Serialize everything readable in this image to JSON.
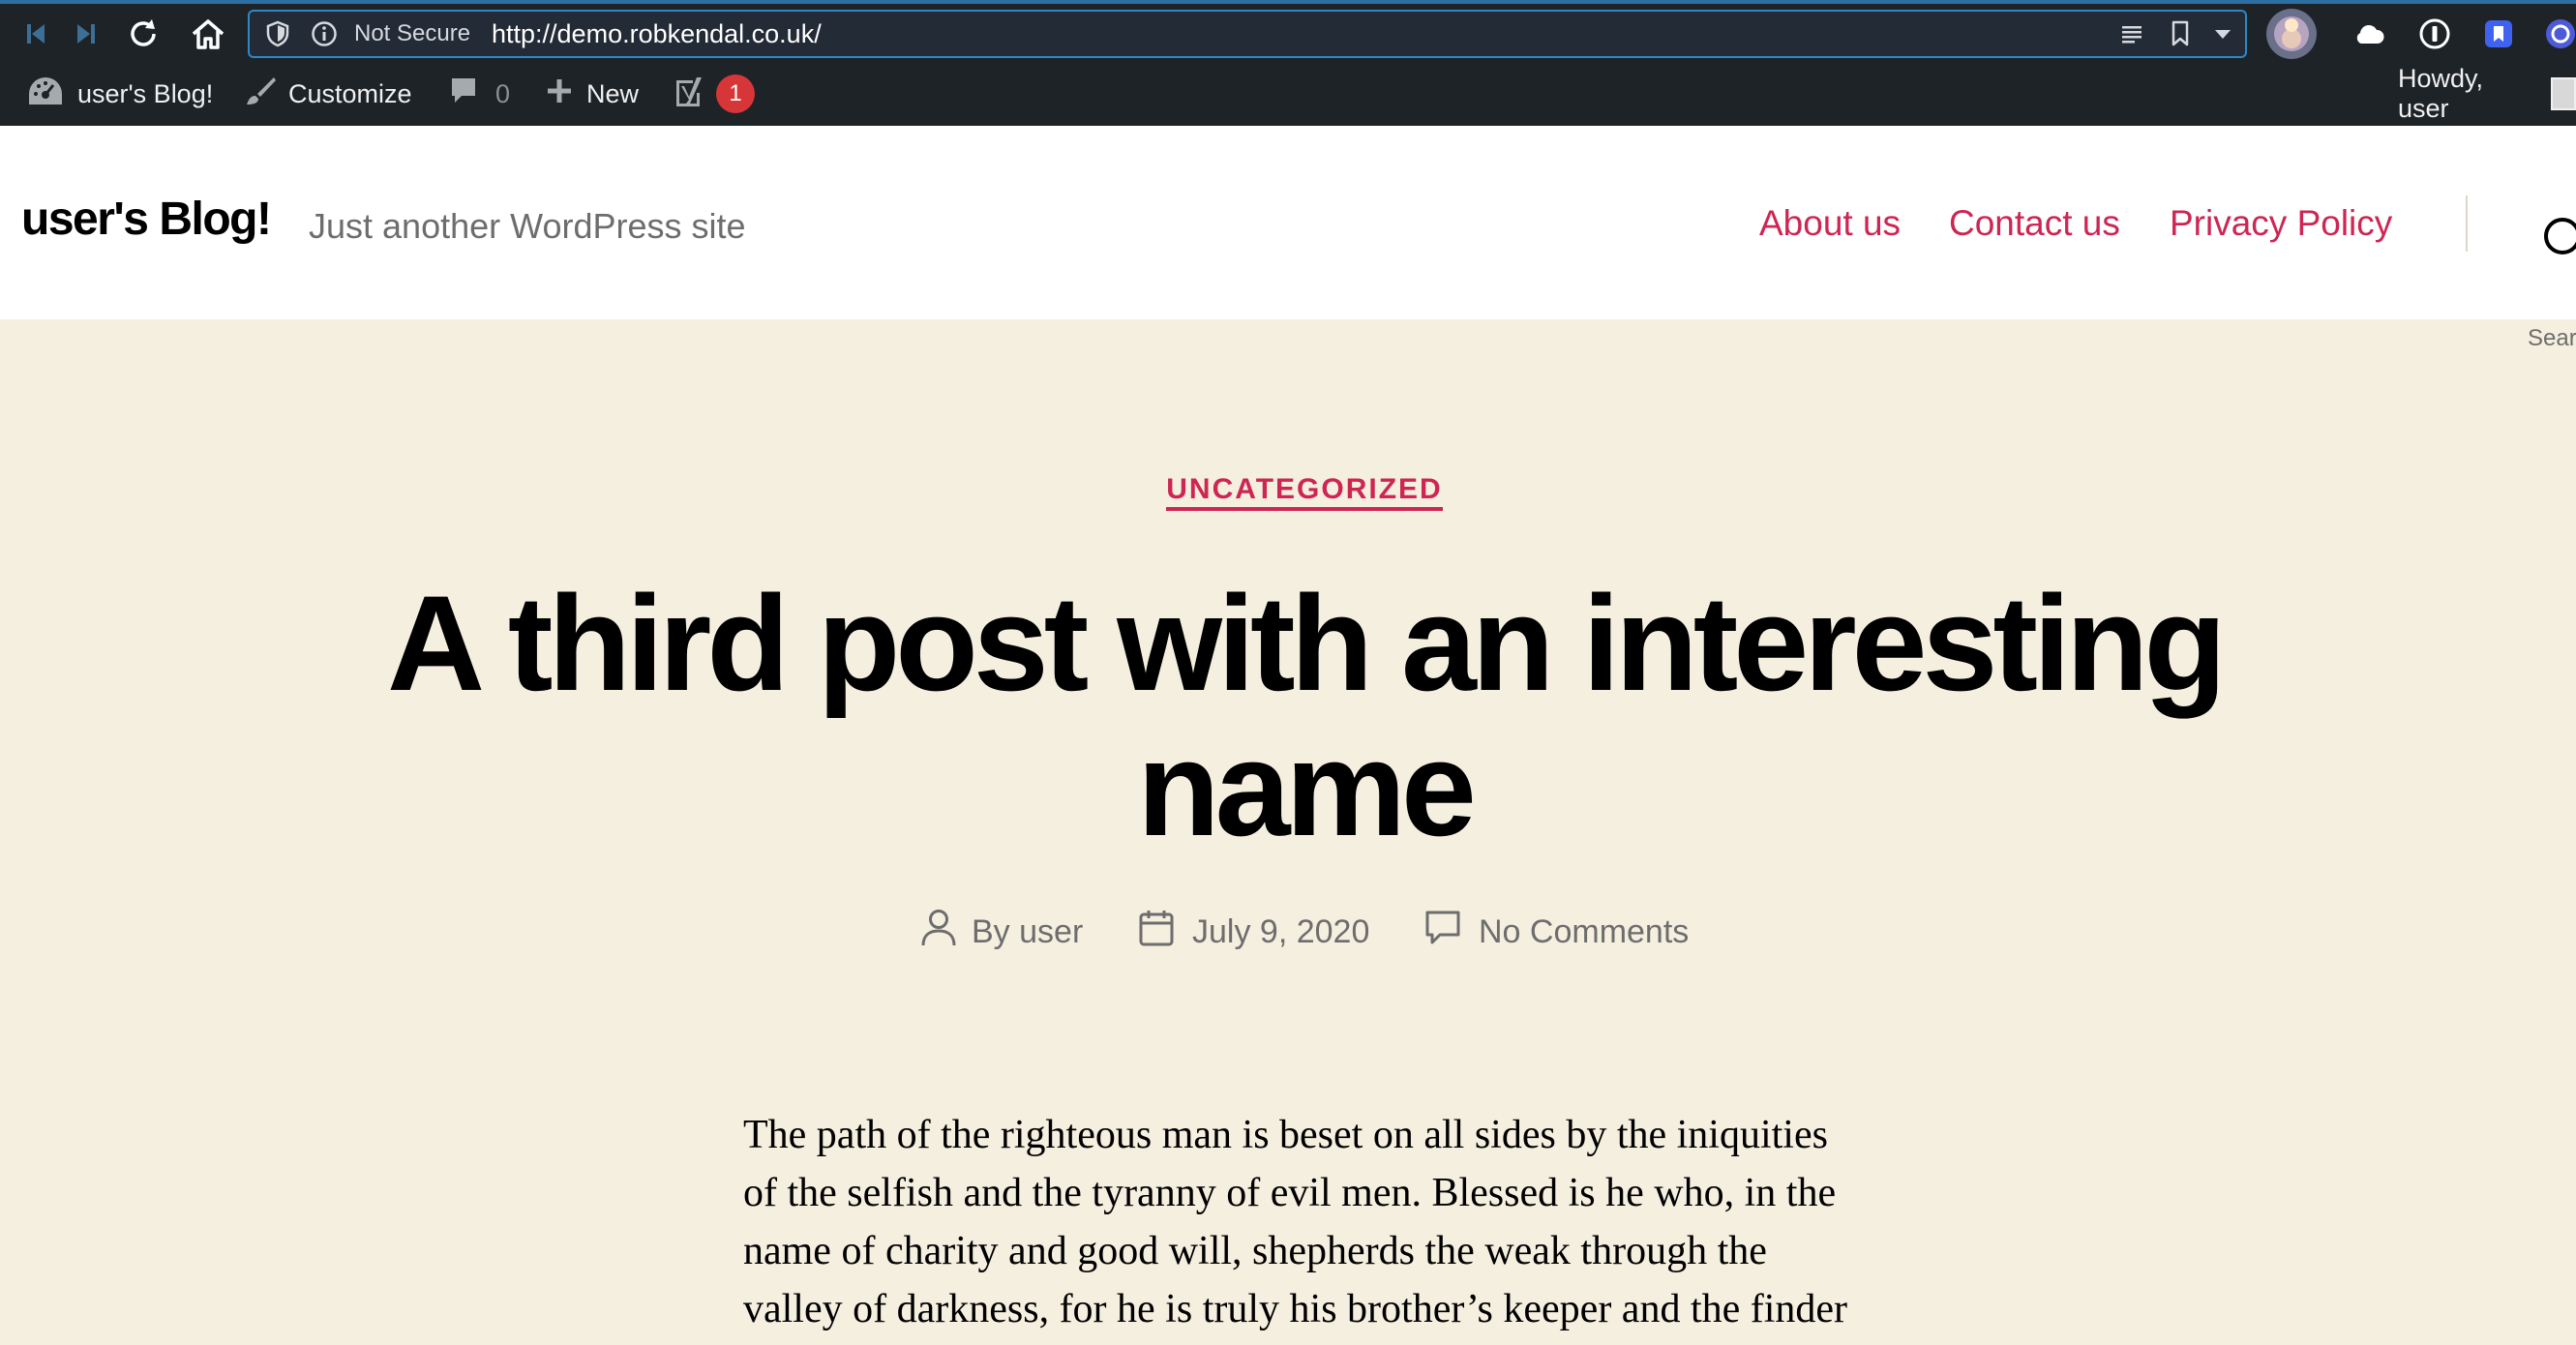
{
  "browser": {
    "security_label": "Not Secure",
    "url": "http://demo.robkendal.co.uk/"
  },
  "admin_bar": {
    "site_name": "user's Blog!",
    "customize": "Customize",
    "comments_count": "0",
    "new_label": "New",
    "yoast_notifications": "1",
    "greeting": "Howdy, user"
  },
  "header": {
    "site_title": "user's Blog!",
    "site_description": "Just another WordPress site",
    "nav": [
      "About us",
      "Contact us",
      "Privacy Policy"
    ],
    "search_label": "Sear"
  },
  "post": {
    "category": "UNCATEGORIZED",
    "title_line1": "A third post with an interesting",
    "title_line2": "name",
    "author": "By user",
    "date": "July 9, 2020",
    "comments": "No Comments",
    "body_lines": [
      "The path of the righteous man is beset on all sides by the iniquities",
      "of the selfish and the tyranny of evil men. Blessed is he who, in the",
      "name of charity and good will, shepherds the weak through the",
      "valley of darkness, for he is truly his brother’s keeper and the finder"
    ]
  },
  "colors": {
    "accent": "#cd2653",
    "page_background": "#f5efe0",
    "admin_bar": "#1d2327"
  }
}
